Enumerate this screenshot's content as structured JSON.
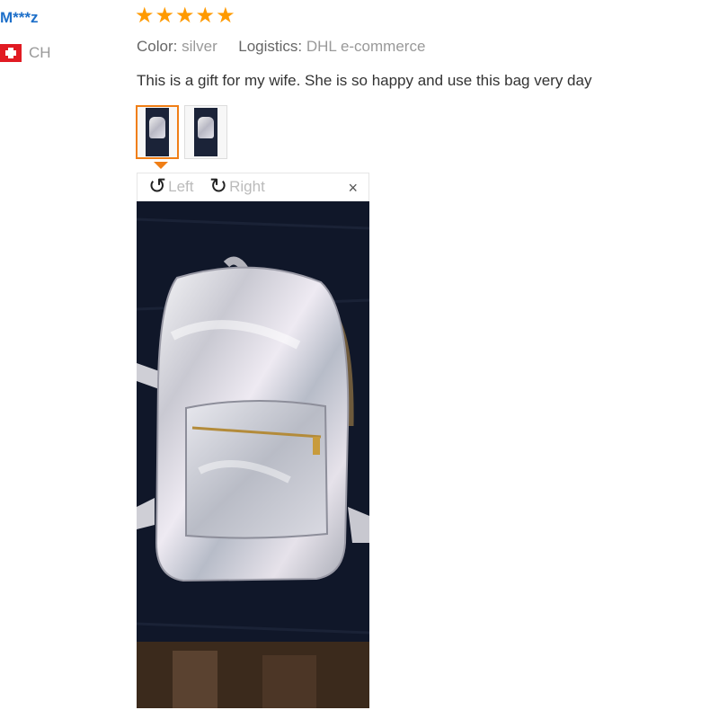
{
  "reviewer": {
    "name": "M***z",
    "country_code": "CH",
    "flag_icon": "swiss-flag-icon"
  },
  "review": {
    "rating": 5,
    "star_glyph": "★",
    "star_color": "#ff9a00",
    "attributes": [
      {
        "key": "Color:",
        "value": "silver"
      },
      {
        "key": "Logistics:",
        "value": "DHL e-commerce"
      }
    ],
    "text": "This is a gift for my wife. She is so happy and use this bag very day"
  },
  "photos": {
    "thumbnails": [
      {
        "name": "photo-1",
        "selected": true
      },
      {
        "name": "photo-2",
        "selected": false
      }
    ],
    "accent_color": "#f07e15"
  },
  "viewer": {
    "rotate_left_label": "Left",
    "rotate_right_label": "Right",
    "rotate_left_glyph": "↺",
    "rotate_right_glyph": "↻",
    "close_glyph": "×"
  }
}
